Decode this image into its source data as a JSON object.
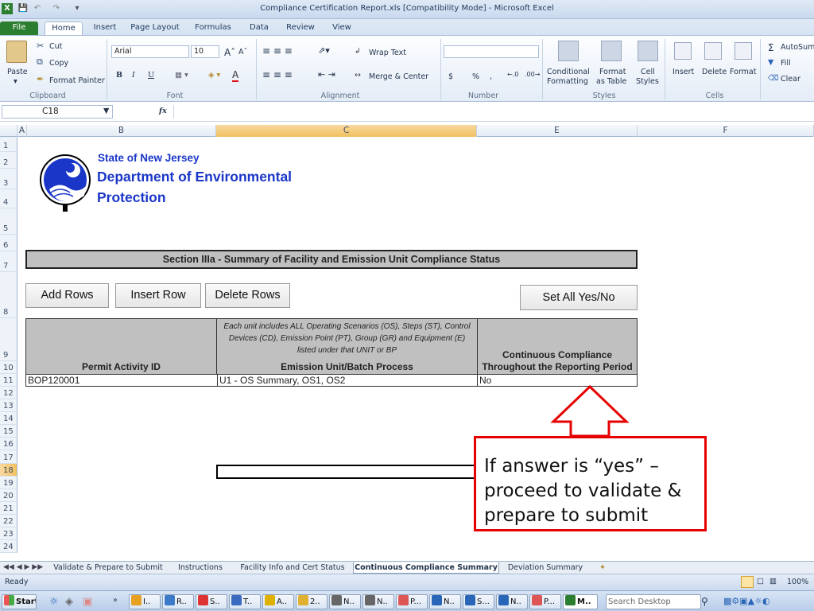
{
  "window": {
    "title": "Compliance Certification Report.xls  [Compatibility Mode]  -  Microsoft Excel"
  },
  "ribbon_tabs": [
    "File",
    "Home",
    "Insert",
    "Page Layout",
    "Formulas",
    "Data",
    "Review",
    "View"
  ],
  "ribbon": {
    "clipboard": {
      "label": "Clipboard",
      "paste": "Paste",
      "cut": "Cut",
      "copy": "Copy",
      "format_painter": "Format Painter"
    },
    "font": {
      "label": "Font",
      "name": "Arial",
      "size": "10",
      "bold": "B",
      "italic": "I",
      "underline": "U"
    },
    "alignment": {
      "label": "Alignment",
      "wrap": "Wrap Text",
      "merge": "Merge & Center"
    },
    "number": {
      "label": "Number",
      "dollar": "$",
      "percent": "%",
      "comma": ","
    },
    "styles": {
      "label": "Styles",
      "conditional": "Conditional",
      "conditional2": "Formatting",
      "format_as": "Format",
      "format_as2": "as Table",
      "cell": "Cell",
      "cell2": "Styles"
    },
    "cells": {
      "label": "Cells",
      "insert": "Insert",
      "delete": "Delete",
      "format": "Format"
    },
    "editing": {
      "autosum": "AutoSum",
      "fill": "Fill",
      "clear": "Clear"
    }
  },
  "formula_bar": {
    "name_box": "C18",
    "fx": "fx",
    "value": ""
  },
  "columns": [
    "A",
    "B",
    "C",
    "E",
    "F"
  ],
  "rows": [
    "1",
    "2",
    "3",
    "4",
    "5",
    "6",
    "7",
    "8",
    "9",
    "10",
    "11",
    "12",
    "13",
    "14",
    "15",
    "16",
    "17",
    "18",
    "19",
    "20",
    "21",
    "22",
    "23",
    "24"
  ],
  "sheet": {
    "org_line1": "State of New Jersey",
    "org_line2": "Department of Environmental",
    "org_line3": "Protection",
    "section_title": "Section IIIa - Summary of Facility and Emission Unit Compliance Status",
    "buttons": {
      "add_rows": "Add Rows",
      "insert_row": "Insert Row",
      "delete_rows": "Delete Rows",
      "set_all": "Set All Yes/No"
    },
    "table": {
      "col1_header": "Permit Activity ID",
      "col2_note": "Each unit includes ALL Operating Scenarios (OS), Steps (ST), Control Devices (CD), Emission Point (PT), Group (GR) and Equipment (E) listed under that UNIT or BP",
      "col2_header": "Emission Unit/Batch Process",
      "col3_header1": "Continuous Compliance",
      "col3_header2": "Throughout the Reporting Period",
      "rows": [
        {
          "permit_id": "BOP120001",
          "unit": "U1 - OS Summary, OS1, OS2",
          "compliance": "No"
        }
      ]
    },
    "callout": "If answer is “yes” – proceed to validate & prepare to submit"
  },
  "sheet_tabs": [
    "Validate & Prepare to Submit",
    "Instructions",
    "Facility Info and Cert Status",
    "Continuous Compliance Summary",
    "Deviation Summary"
  ],
  "active_sheet": "Continuous Compliance Summary",
  "status": {
    "text": "Ready",
    "zoom": "100%"
  },
  "taskbar": {
    "start": "Start",
    "items": [
      "I..",
      "R..",
      "S..",
      "T..",
      "A..",
      "2..",
      "N..",
      "N..",
      "P...",
      "N..",
      "S...",
      "N..",
      "P...",
      "M.."
    ],
    "search_placeholder": "Search Desktop"
  },
  "colors": {
    "nj_blue": "#1a36c8",
    "callout_red": "#e60000",
    "excel_green": "#2b7d2f"
  }
}
